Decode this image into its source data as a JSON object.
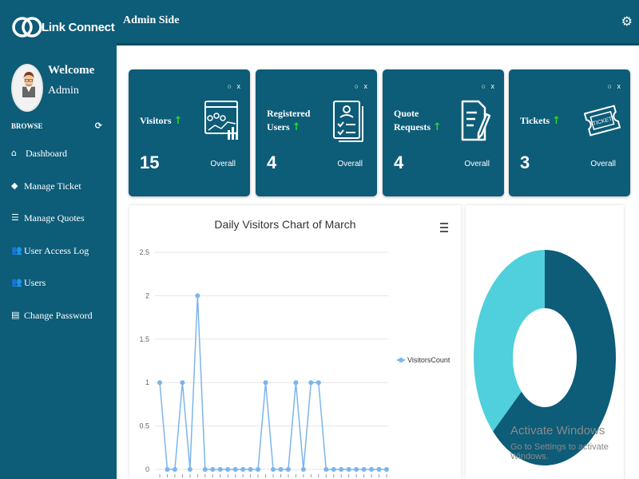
{
  "app": {
    "logo_text": "Link Connect"
  },
  "header": {
    "title": "Admin Side",
    "settings_icon": "gear-icon"
  },
  "profile": {
    "welcome": "Welcome",
    "name": "Admin"
  },
  "sidebar": {
    "section_label": "BROWSE",
    "items": [
      {
        "label": "Dashboard",
        "icon": "home-icon"
      },
      {
        "label": "Manage Ticket",
        "icon": "tag-icon"
      },
      {
        "label": "Manage Quotes",
        "icon": "list-icon"
      },
      {
        "label": "User Access Log",
        "icon": "users-icon"
      },
      {
        "label": "Users",
        "icon": "users-icon"
      },
      {
        "label": "Change Password",
        "icon": "file-icon"
      }
    ]
  },
  "cards": [
    {
      "label": "Visitors",
      "value": "15",
      "overall": "Overall",
      "controls": "○ x",
      "icon": "analytics-icon"
    },
    {
      "label": "Registered Users",
      "line1": "Registered",
      "line2": "Users",
      "value": "4",
      "overall": "Overall",
      "controls": "○ x",
      "icon": "id-card-icon"
    },
    {
      "label": "Quote Requests",
      "line1": "Quote",
      "line2": "Requests",
      "value": "4",
      "overall": "Overall",
      "controls": "○ x",
      "icon": "document-pen-icon"
    },
    {
      "label": "Tickets",
      "value": "3",
      "overall": "Overall",
      "controls": "○ x",
      "icon": "ticket-icon"
    }
  ],
  "colors": {
    "primary": "#0d5c78",
    "accent_up": "#2bd62b",
    "line": "#7cb5ec",
    "donut_a": "#0d5c78",
    "donut_b": "#4fd0dc"
  },
  "chart_data": [
    {
      "type": "line",
      "title": "Daily Visitors Chart of March",
      "series": [
        {
          "name": "VisitorsCount",
          "values": [
            1,
            0,
            0,
            1,
            0,
            2,
            0,
            0,
            0,
            0,
            0,
            0,
            0,
            0,
            1,
            0,
            0,
            0,
            1,
            0,
            1,
            1,
            0,
            0,
            0,
            0,
            0,
            0,
            0,
            0,
            0
          ]
        }
      ],
      "y_ticks": [
        "0",
        "0.5",
        "1",
        "1.5",
        "2",
        "2.5"
      ],
      "ylim": [
        0,
        2.5
      ],
      "grid": true,
      "legend": "right"
    },
    {
      "type": "pie",
      "donut": true,
      "values": [
        63,
        37
      ]
    }
  ],
  "watermark": {
    "title": "Activate Windows",
    "subtitle": "Go to Settings to activate Windows."
  }
}
